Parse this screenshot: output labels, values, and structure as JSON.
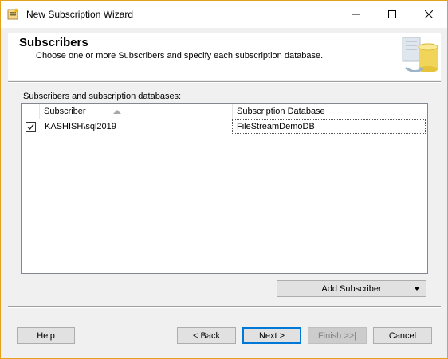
{
  "window": {
    "title": "New Subscription Wizard"
  },
  "banner": {
    "title": "Subscribers",
    "subtitle": "Choose one or more Subscribers and specify each subscription database."
  },
  "grid": {
    "label": "Subscribers and subscription databases:",
    "columns": [
      "Subscriber",
      "Subscription Database"
    ],
    "sort": "ascending",
    "rows": [
      {
        "checked": true,
        "subscriber": "KASHISH\\sql2019",
        "database": "FileStreamDemoDB"
      }
    ]
  },
  "buttons": {
    "add_subscriber": "Add Subscriber",
    "help": "Help",
    "back": "< Back",
    "next": "Next >",
    "finish": "Finish >>|",
    "cancel": "Cancel"
  },
  "icons": {
    "app": "wizard-app-icon",
    "banner": "database-cylinder-icon",
    "minimize": "minimize-icon",
    "maximize": "maximize-icon",
    "close": "close-icon",
    "sort": "sort-ascending-icon",
    "dropdown": "dropdown-arrow-icon",
    "checkbox": "checkbox-checked-icon"
  },
  "colors": {
    "window_border": "#e3a21a",
    "default_button_border": "#0078d7",
    "dialog_background": "#f0f0f0"
  }
}
